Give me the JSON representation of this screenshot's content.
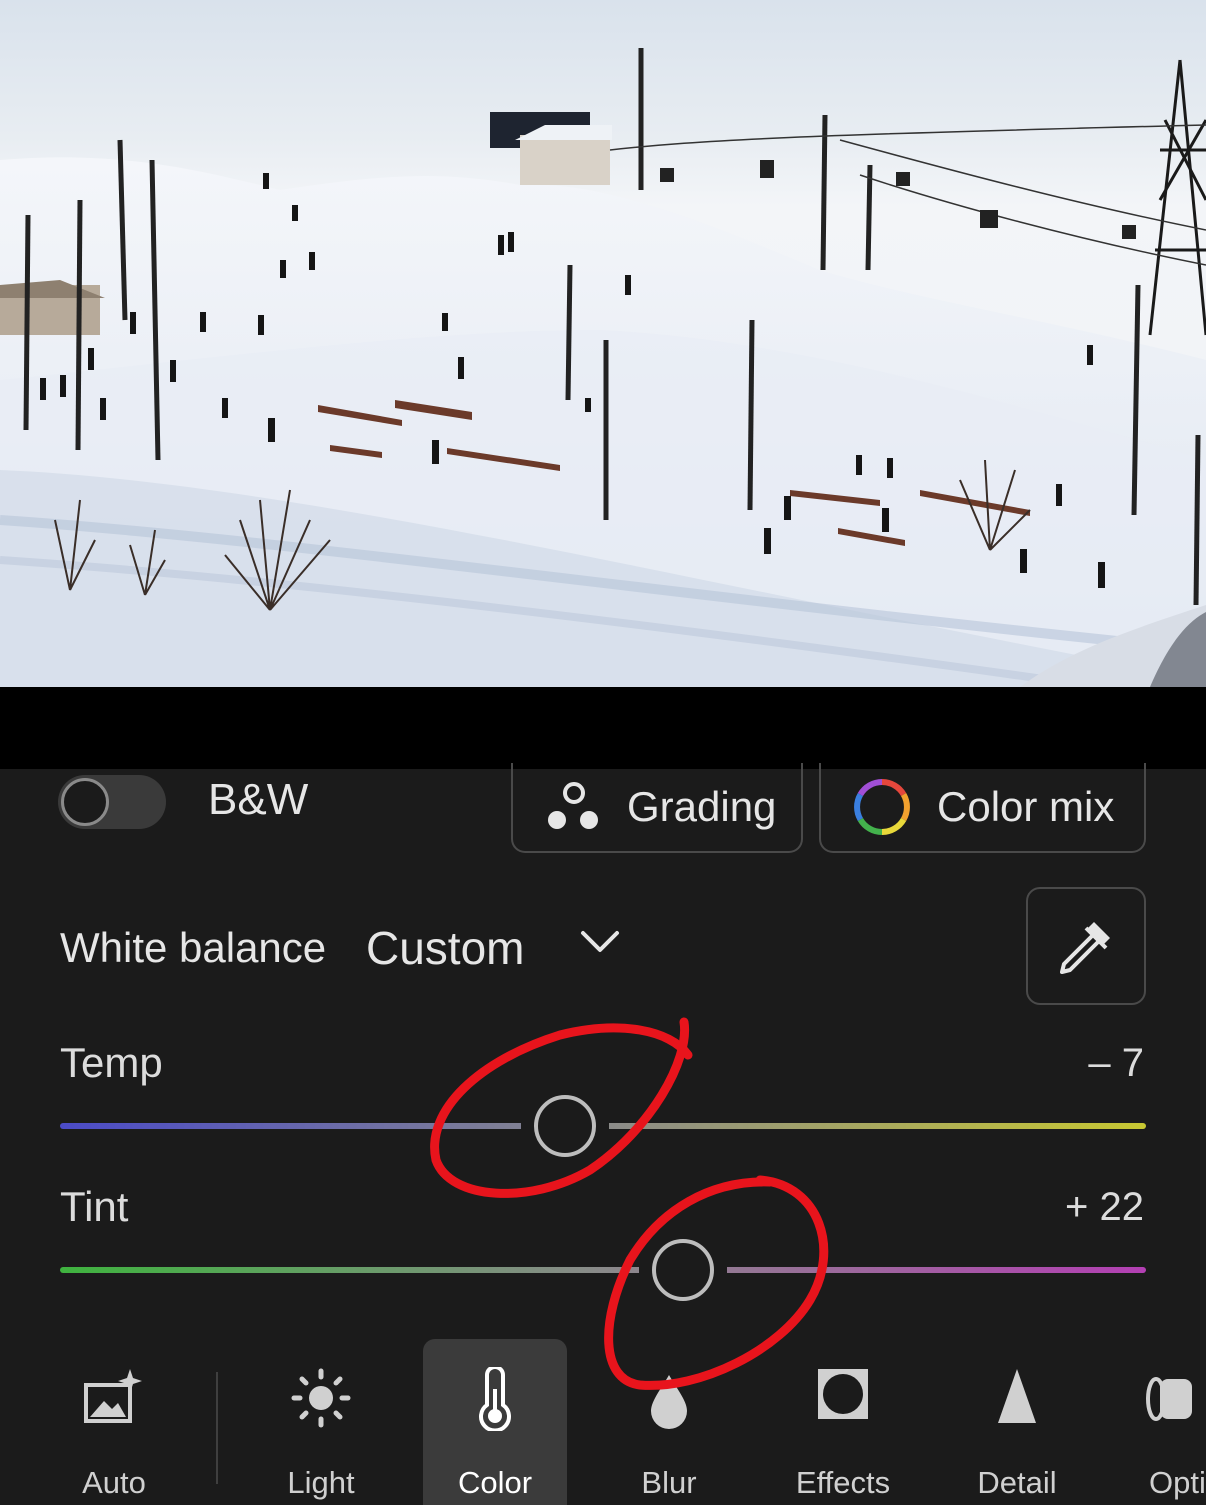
{
  "bw_toggle": {
    "label": "B&W",
    "on": false
  },
  "grading_button": {
    "label": "Grading",
    "icon": "grading-dots-icon"
  },
  "colormix_button": {
    "label": "Color mix",
    "icon": "color-wheel-icon"
  },
  "white_balance": {
    "label": "White balance",
    "value": "Custom",
    "icon": "chevron-down-icon",
    "eyedropper_icon": "eyedropper-icon"
  },
  "temp": {
    "label": "Temp",
    "value": "– 7",
    "numeric": -7,
    "range": [
      -100,
      100
    ],
    "colors": [
      "#4b4bc8",
      "#c8c832"
    ]
  },
  "tint": {
    "label": "Tint",
    "value": "+ 22",
    "numeric": 22,
    "range": [
      -150,
      150
    ],
    "colors": [
      "#3fb33f",
      "#b33fb3"
    ]
  },
  "toolbar": {
    "items": [
      {
        "label": "Auto",
        "icon": "auto-enhance-icon"
      },
      {
        "label": "Light",
        "icon": "sun-icon"
      },
      {
        "label": "Color",
        "icon": "thermometer-icon",
        "active": true
      },
      {
        "label": "Blur",
        "icon": "drop-icon"
      },
      {
        "label": "Effects",
        "icon": "vignette-icon"
      },
      {
        "label": "Detail",
        "icon": "triangle-icon"
      },
      {
        "label": "Opti",
        "icon": "optics-icon"
      }
    ]
  },
  "annotation_color": "#e8141c"
}
